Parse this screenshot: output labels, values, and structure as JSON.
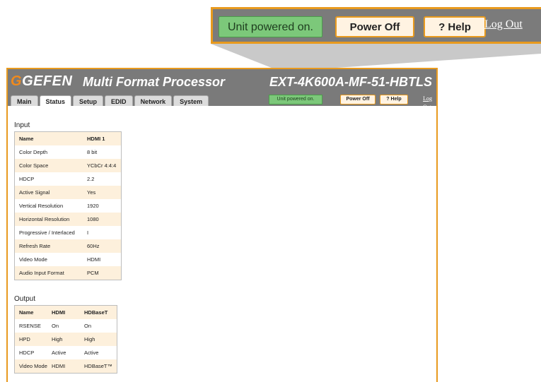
{
  "header": {
    "brand": "GEFEN",
    "app_title": "Multi Format Processor",
    "model": "EXT-4K600A-MF-51-HBTLS"
  },
  "tabs": [
    {
      "label": "Main"
    },
    {
      "label": "Status"
    },
    {
      "label": "Setup"
    },
    {
      "label": "EDID"
    },
    {
      "label": "Network"
    },
    {
      "label": "System"
    }
  ],
  "controls": {
    "status": "Unit powered on.",
    "power_off": "Power Off",
    "help": "? Help",
    "logout": "Log Out"
  },
  "input": {
    "title": "Input",
    "rows": [
      [
        "Name",
        "HDMI 1"
      ],
      [
        "Color Depth",
        "8 bit"
      ],
      [
        "Color Space",
        "YCbCr 4:4:4"
      ],
      [
        "HDCP",
        "2.2"
      ],
      [
        "Active Signal",
        "Yes"
      ],
      [
        "Vertical Resolution",
        "1920"
      ],
      [
        "Horizontal Resolution",
        "1080"
      ],
      [
        "Progressive / Interlaced",
        "I"
      ],
      [
        "Refresh Rate",
        "60Hz"
      ],
      [
        "Video Mode",
        "HDMI"
      ],
      [
        "Audio Input Format",
        "PCM"
      ]
    ]
  },
  "output": {
    "title": "Output",
    "rows": [
      [
        "Name",
        "HDMI",
        "HDBaseT"
      ],
      [
        "RSENSE",
        "On",
        "On"
      ],
      [
        "HPD",
        "High",
        "High"
      ],
      [
        "HDCP",
        "Active",
        "Active"
      ],
      [
        "Video Mode",
        "HDMI",
        "HDBaseT™"
      ]
    ]
  },
  "colors": {
    "accent": "#e89a1e",
    "status_green": "#7cc87a",
    "frame_gray": "#7a7a7a",
    "row_tint": "#fdf0dc"
  }
}
